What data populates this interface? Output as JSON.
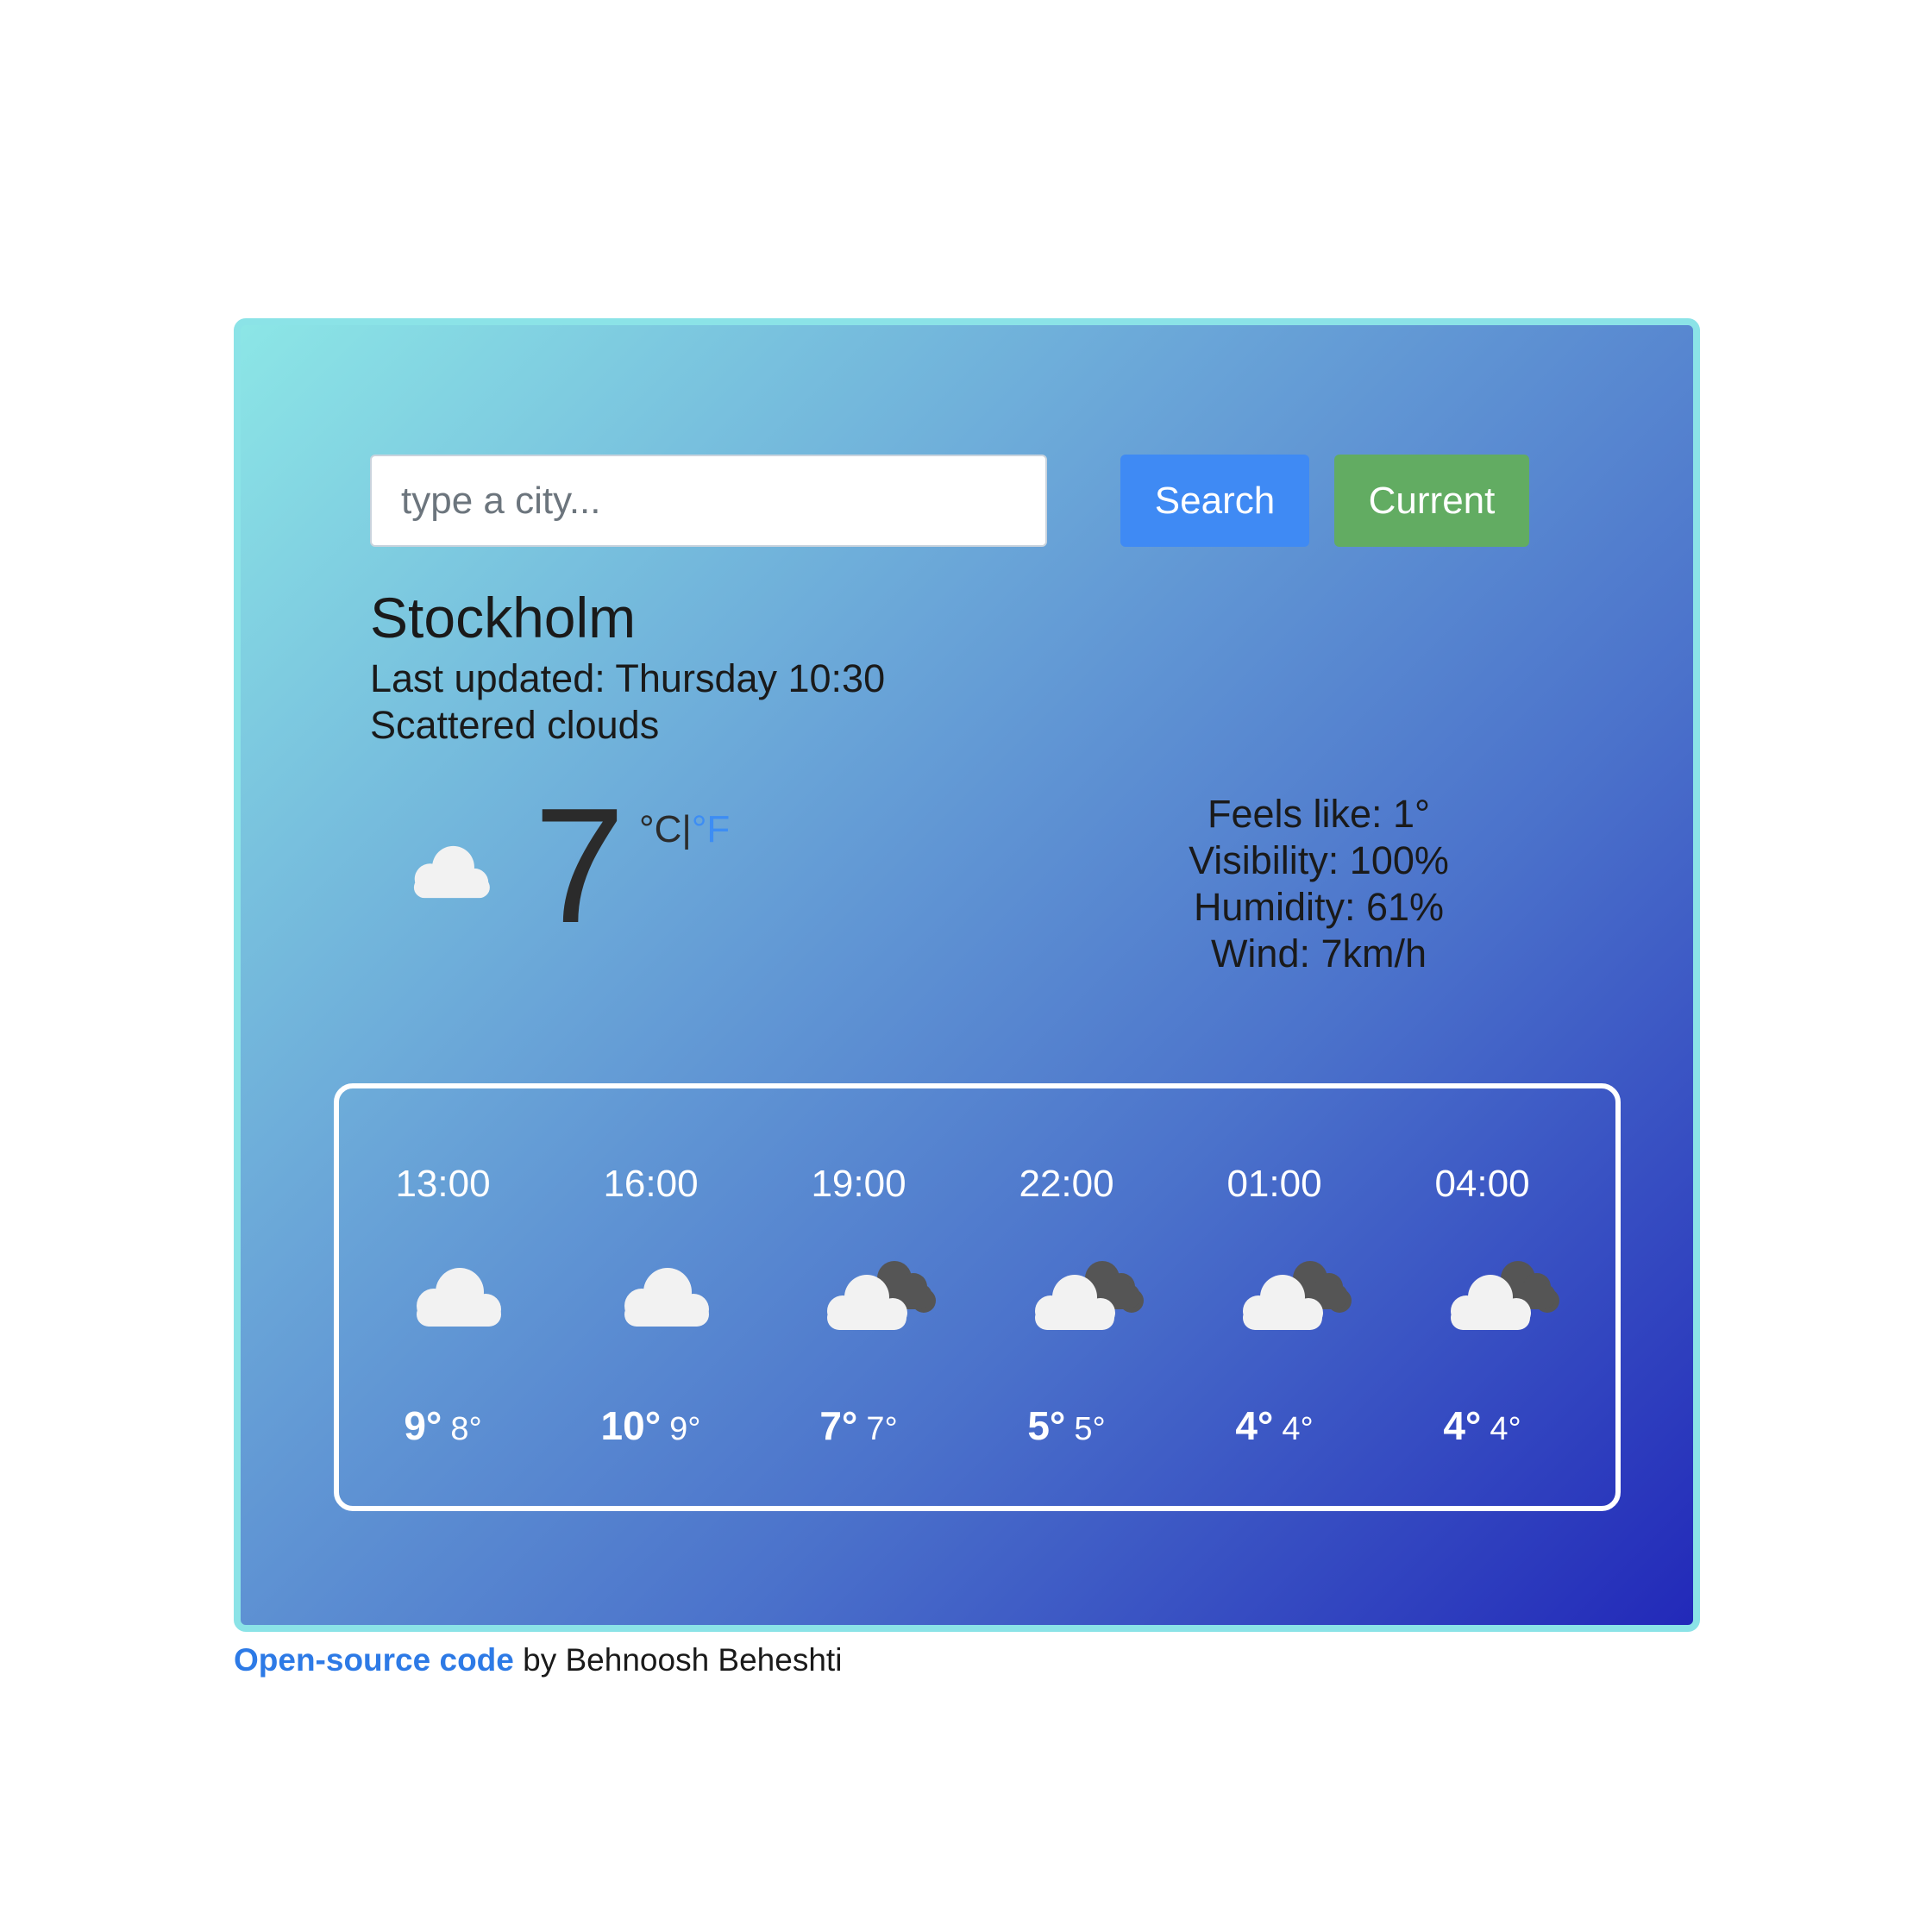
{
  "search": {
    "placeholder": "type a city...",
    "value": "",
    "search_label": "Search",
    "current_label": "Current"
  },
  "weather": {
    "city": "Stockholm",
    "last_updated": "Last updated: Thursday 10:30",
    "description": "Scattered clouds",
    "icon": "cloud-icon",
    "temperature": "7",
    "unit_celsius": "°C",
    "unit_separator": "|",
    "unit_fahrenheit": "°F",
    "feels_like": "Feels like: 1°",
    "visibility": "Visibility: 100%",
    "humidity": "Humidity: 61%",
    "wind": "Wind: 7km/h"
  },
  "forecast": [
    {
      "time": "13:00",
      "icon": "cloud-icon",
      "max": "9°",
      "min": "8°"
    },
    {
      "time": "16:00",
      "icon": "cloud-icon",
      "max": "10°",
      "min": "9°"
    },
    {
      "time": "19:00",
      "icon": "broken-clouds-icon",
      "max": "7°",
      "min": "7°"
    },
    {
      "time": "22:00",
      "icon": "broken-clouds-icon",
      "max": "5°",
      "min": "5°"
    },
    {
      "time": "01:00",
      "icon": "broken-clouds-icon",
      "max": "4°",
      "min": "4°"
    },
    {
      "time": "04:00",
      "icon": "broken-clouds-icon",
      "max": "4°",
      "min": "4°"
    }
  ],
  "footer": {
    "link_text": "Open-source code",
    "author_text": " by Behnoosh Beheshti"
  },
  "colors": {
    "search_button": "#3f8af4",
    "current_button": "#62ac62",
    "gradient_start": "#8ce6e6",
    "gradient_end": "#2229b9",
    "link": "#2d7ae6"
  }
}
